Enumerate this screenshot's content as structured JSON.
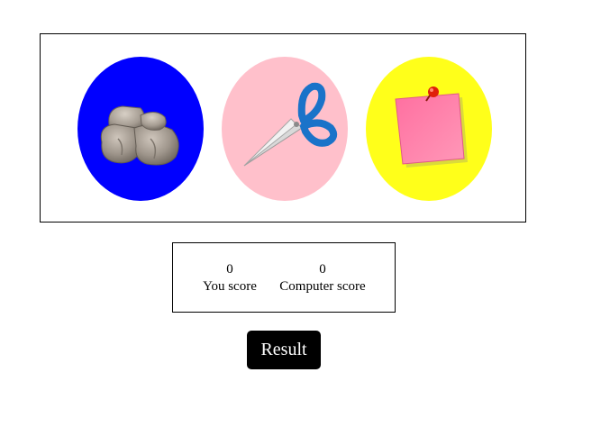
{
  "choices": [
    {
      "name": "rock",
      "icon": "rock-icon",
      "background": "#0000ff"
    },
    {
      "name": "scissors",
      "icon": "scissors-icon",
      "background": "#ffc0cb"
    },
    {
      "name": "paper",
      "icon": "sticky-note-icon",
      "background": "#ffff1a"
    }
  ],
  "score": {
    "user_value": "0",
    "user_label": "You score",
    "computer_value": "0",
    "computer_label": "Computer score"
  },
  "result_button_label": "Result"
}
